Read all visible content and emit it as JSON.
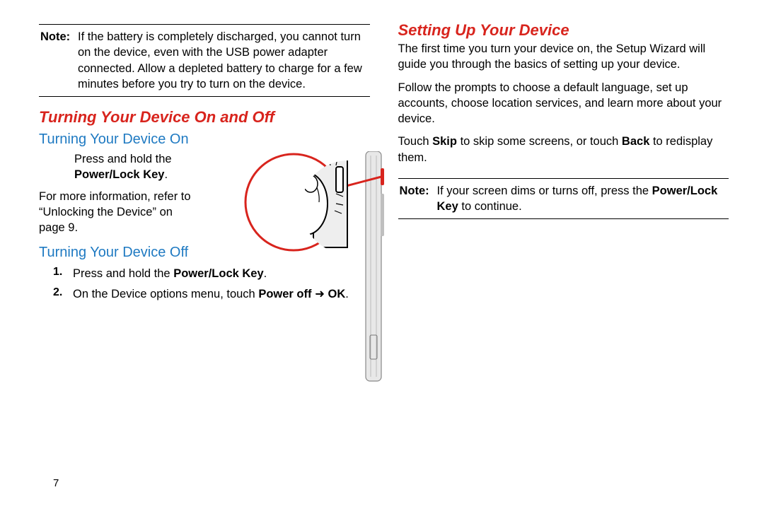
{
  "page_number": "7",
  "left": {
    "note_label": "Note:",
    "note_body": "If the battery is completely discharged, you cannot turn on the device, even with the USB power adapter connected. Allow a depleted battery to charge for a few minutes before you try to turn on the device.",
    "h1": "Turning Your Device On and Off",
    "h2a": "Turning Your Device On",
    "on_press": "Press and hold the ",
    "on_press_bold": "Power/Lock Key",
    "on_press_tail": ".",
    "on_info": "For more information, refer to “Unlocking the Device” on page 9.",
    "h2b": "Turning Your Device Off",
    "off_1_a": "Press and hold the ",
    "off_1_b": "Power/Lock Key",
    "off_1_c": ".",
    "off_2_a": "On the Device options menu, touch ",
    "off_2_b": "Power off",
    "off_2_arrow": " ➜ ",
    "off_2_c": "OK",
    "off_2_d": "."
  },
  "right": {
    "h1": "Setting Up Your Device",
    "p1": "The first time you turn your device on, the Setup Wizard will guide you through the basics of setting up your device.",
    "p2": "Follow the prompts to choose a default language, set up accounts, choose location services, and learn more about your device.",
    "p3_a": "Touch ",
    "p3_b": "Skip",
    "p3_c": " to skip some screens, or touch ",
    "p3_d": "Back",
    "p3_e": " to redisplay them.",
    "note_label": "Note:",
    "note_a": "If your screen dims or turns off, press the ",
    "note_b": "Power/Lock Key",
    "note_c": " to continue."
  }
}
